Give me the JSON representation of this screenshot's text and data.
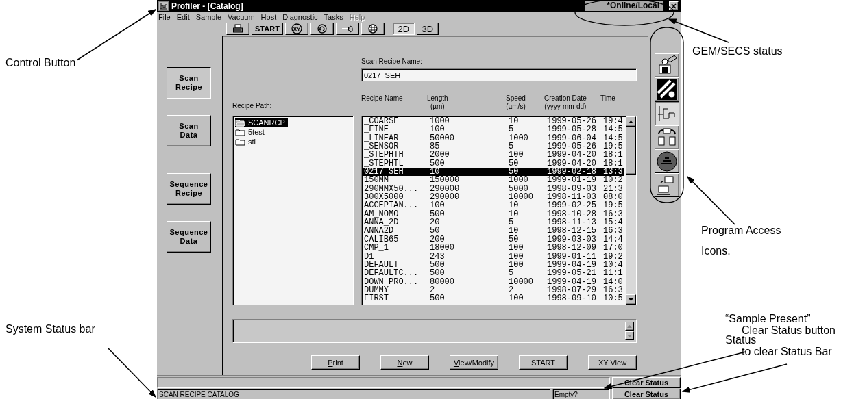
{
  "window": {
    "title": "Profiler - [Catalog]",
    "gem_secs_status": "*Online/Local"
  },
  "menu": [
    {
      "label": "File",
      "disabled": false
    },
    {
      "label": "Edit",
      "disabled": false
    },
    {
      "label": "Sample",
      "disabled": false
    },
    {
      "label": "Vacuum",
      "disabled": false
    },
    {
      "label": "Host",
      "disabled": false
    },
    {
      "label": "Diagnostic",
      "disabled": false
    },
    {
      "label": "Tasks",
      "disabled": false
    },
    {
      "label": "Help",
      "disabled": true
    }
  ],
  "toolbar": [
    {
      "kind": "printer",
      "selected": false
    },
    {
      "kind": "text",
      "label": "START",
      "selected": false
    },
    {
      "kind": "xy",
      "label": "XY",
      "selected": false
    },
    {
      "kind": "rotate",
      "selected": false
    },
    {
      "kind": "arrow",
      "selected": false
    },
    {
      "kind": "globe",
      "selected": false
    },
    {
      "kind": "text",
      "label": "2D",
      "selected": true
    },
    {
      "kind": "text",
      "label": "3D",
      "selected": false
    }
  ],
  "nav": [
    {
      "label": "Scan Recipe",
      "selected": true
    },
    {
      "label": "Scan Data",
      "selected": false
    },
    {
      "label": "Sequence Recipe",
      "selected": false
    },
    {
      "label": "Sequence Data",
      "selected": false
    }
  ],
  "form": {
    "name_label": "Scan Recipe Name:",
    "name_value": "0217_SEH",
    "path_label": "Recipe Path:"
  },
  "tree": [
    {
      "label": "SCANRCP",
      "selected": true,
      "expanded": true
    },
    {
      "label": "5test",
      "selected": false,
      "expanded": false
    },
    {
      "label": "sti",
      "selected": false,
      "expanded": false
    }
  ],
  "table": {
    "columns": [
      {
        "label": "Recipe Name"
      },
      {
        "label": "Length",
        "unit": "(µm)"
      },
      {
        "label": "Speed",
        "unit": "(µm/s)"
      },
      {
        "label": "Creation Date",
        "unit": "(yyyy-mm-dd)"
      },
      {
        "label": "Time"
      }
    ],
    "rows": [
      {
        "cells": [
          "_COARSE",
          "1000",
          "10",
          "1999-05-26",
          "19:4"
        ],
        "selected": false
      },
      {
        "cells": [
          "_FINE",
          "100",
          "5",
          "1999-05-28",
          "14:5"
        ],
        "selected": false
      },
      {
        "cells": [
          "_LINEAR",
          "50000",
          "1000",
          "1999-06-04",
          "14:5"
        ],
        "selected": false
      },
      {
        "cells": [
          "_SENSOR",
          "85",
          "5",
          "1999-05-26",
          "19:5"
        ],
        "selected": false
      },
      {
        "cells": [
          "_STEPHTH",
          "2000",
          "100",
          "1999-04-20",
          "18:1"
        ],
        "selected": false
      },
      {
        "cells": [
          "_STEPHTL",
          "500",
          "50",
          "1999-04-20",
          "18:1"
        ],
        "selected": false
      },
      {
        "cells": [
          "0217_SEH",
          "10",
          "50",
          "1999-02-18",
          "13:3"
        ],
        "selected": true
      },
      {
        "cells": [
          "150MM",
          "150000",
          "1000",
          "1999-01-19",
          "10:2"
        ],
        "selected": false
      },
      {
        "cells": [
          "290MMX50...",
          "290000",
          "5000",
          "1998-09-03",
          "21:3"
        ],
        "selected": false
      },
      {
        "cells": [
          "300X5000",
          "290000",
          "10000",
          "1998-11-03",
          "08:0"
        ],
        "selected": false
      },
      {
        "cells": [
          "ACCEPTAN...",
          "100",
          "10",
          "1999-02-25",
          "19:5"
        ],
        "selected": false
      },
      {
        "cells": [
          "AM_NOMO",
          "500",
          "10",
          "1998-10-28",
          "16:3"
        ],
        "selected": false
      },
      {
        "cells": [
          "ANNA_2D",
          "20",
          "5",
          "1998-11-13",
          "15:4"
        ],
        "selected": false
      },
      {
        "cells": [
          "ANNA2D",
          "50",
          "10",
          "1998-12-15",
          "16:3"
        ],
        "selected": false
      },
      {
        "cells": [
          "CALIB65",
          "200",
          "50",
          "1999-03-03",
          "14:4"
        ],
        "selected": false
      },
      {
        "cells": [
          "CMP_1",
          "18000",
          "100",
          "1998-12-09",
          "17:0"
        ],
        "selected": false
      },
      {
        "cells": [
          "D1",
          "243",
          "100",
          "1999-01-11",
          "19:2"
        ],
        "selected": false
      },
      {
        "cells": [
          "DEFAULT",
          "500",
          "100",
          "1999-04-19",
          "10:4"
        ],
        "selected": false
      },
      {
        "cells": [
          "DEFAULTC...",
          "500",
          "5",
          "1999-05-21",
          "11:1"
        ],
        "selected": false
      },
      {
        "cells": [
          "DOWN_PRO...",
          "80000",
          "10000",
          "1999-04-19",
          "14:0"
        ],
        "selected": false
      },
      {
        "cells": [
          "DUMMY",
          "2",
          "2",
          "1998-07-29",
          "16:3"
        ],
        "selected": false
      },
      {
        "cells": [
          "FIRST",
          "500",
          "100",
          "1998-09-10",
          "10:5"
        ],
        "selected": false
      }
    ]
  },
  "buttons": [
    {
      "label": "Print",
      "mnemonic": true
    },
    {
      "label": "New",
      "mnemonic": true
    },
    {
      "label": "View/Modify",
      "mnemonic": true
    },
    {
      "label": "START",
      "mnemonic": false
    },
    {
      "label": "XY View",
      "mnemonic": false
    }
  ],
  "program_icons": [
    {
      "kind": "machine",
      "selected": false
    },
    {
      "kind": "hatched",
      "selected": false
    },
    {
      "kind": "profile",
      "selected": true
    },
    {
      "kind": "transfer",
      "selected": false
    },
    {
      "kind": "disc",
      "selected": false
    },
    {
      "kind": "computer",
      "selected": false
    }
  ],
  "status_bar": {
    "message": "SCAN RECIPE CATALOG",
    "sample_status": "Empty?",
    "clear_buttons": [
      "Clear Status",
      "Clear Status"
    ]
  },
  "callouts": [
    {
      "lines": [
        "Control Button"
      ]
    },
    {
      "lines": [
        "GEM/SECS status"
      ]
    },
    {
      "lines": [
        "Program Access",
        "Icons."
      ]
    },
    {
      "lines": [
        "System Status bar"
      ]
    },
    {
      "lines": [
        "“Sample Present”",
        "Status"
      ]
    },
    {
      "lines": [
        "Clear Status button",
        "to clear Status Bar"
      ]
    }
  ]
}
